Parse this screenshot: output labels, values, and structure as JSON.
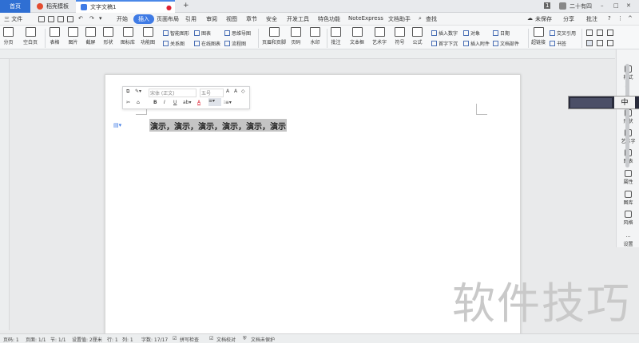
{
  "tabs": {
    "home": "首页",
    "template": "稻壳模板",
    "doc": "文字文稿1",
    "new_tab": "+"
  },
  "titlebar": {
    "badge": "1",
    "user": "二十有四",
    "window_controls": [
      "–",
      "□",
      "✕"
    ]
  },
  "menubar": {
    "file": "三 文件",
    "items": [
      "开始",
      "插入",
      "页面布局",
      "引用",
      "审阅",
      "视图",
      "章节",
      "安全",
      "开发工具",
      "特色功能",
      "NoteExpress",
      "文档助手"
    ],
    "active": "插入",
    "search": "查找",
    "unsaved": "未保存",
    "share": "分享",
    "comment": "批注"
  },
  "ribbon": {
    "big_buttons": [
      "分页",
      "空白页",
      "表格",
      "图片",
      "截屏",
      "形状",
      "图标库",
      "功能图",
      "页眉和页脚",
      "页码",
      "水印",
      "批注",
      "文本框",
      "艺术字",
      "符号",
      "公式",
      "超链接"
    ],
    "small_buttons": [
      "智能图形",
      "图表",
      "思维导图",
      "关系图",
      "在线图表",
      "流程图",
      "插入数字",
      "对象",
      "日期",
      "首字下沉",
      "插入附件",
      "文档部件",
      "交叉引用",
      "书签"
    ]
  },
  "mini_toolbar": {
    "font": "宋体 (正文)",
    "size": "五号",
    "bold": "B",
    "italic": "I",
    "underline": "U",
    "color": "A"
  },
  "document": {
    "line_text": "演示，演示，演示，演示，演示，演示"
  },
  "right_panel": {
    "items": [
      "样式",
      "形状",
      "艺术字",
      "图表",
      "属性",
      "图库",
      "风格",
      "设置"
    ],
    "ime_label": "中"
  },
  "watermark": "软件技巧",
  "statusbar": {
    "items": [
      "页码: 1",
      "页面: 1/1",
      "节: 1/1",
      "设置值: 2厘米",
      "行: 1",
      "列: 1",
      "字数: 17/17",
      "拼写检查",
      "文档校对",
      "文档未保护"
    ]
  },
  "colors": {
    "accent": "#3f7be5",
    "home_tab": "#2f6fd3",
    "selection": "#c4c4c4"
  }
}
